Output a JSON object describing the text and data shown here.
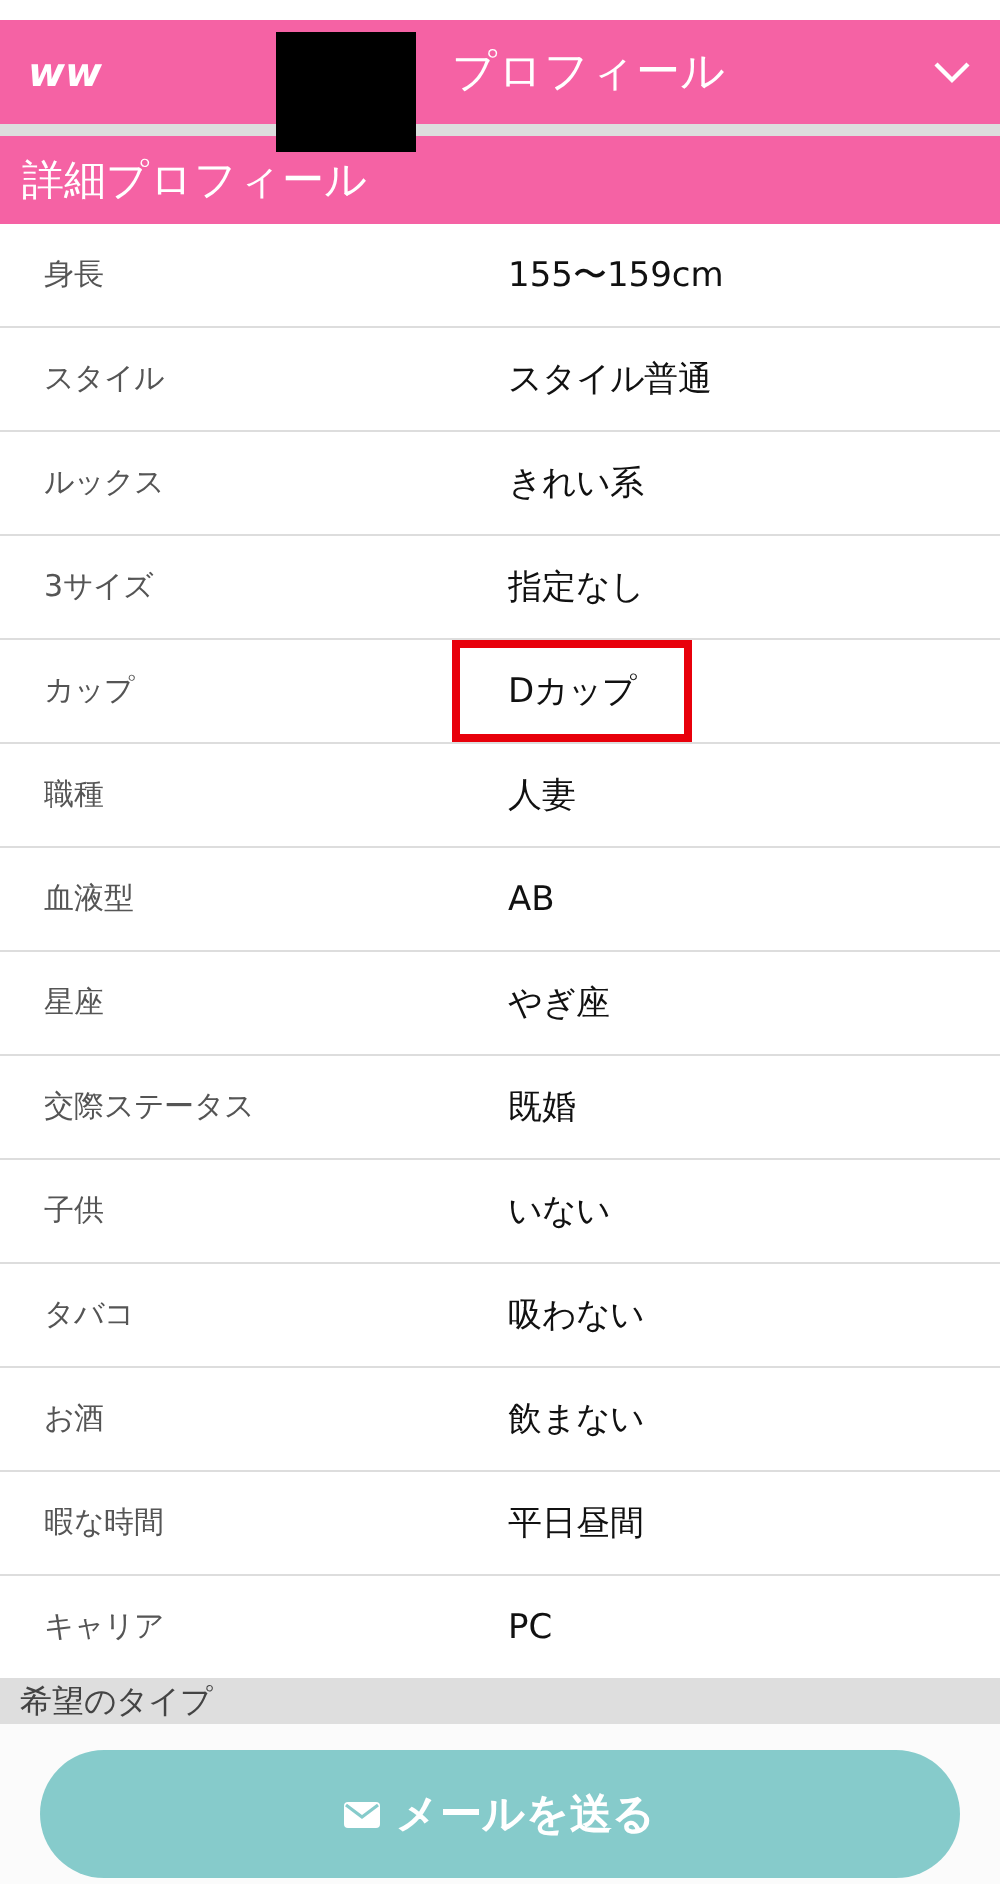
{
  "header": {
    "logo": "ww",
    "title": "プロフィール",
    "redacted": true
  },
  "section": {
    "title": "詳細プロフィール"
  },
  "rows": [
    {
      "label": "身長",
      "value": "155〜159cm",
      "highlighted": false
    },
    {
      "label": "スタイル",
      "value": "スタイル普通",
      "highlighted": false
    },
    {
      "label": "ルックス",
      "value": "きれい系",
      "highlighted": false
    },
    {
      "label": "3サイズ",
      "value": "指定なし",
      "highlighted": false
    },
    {
      "label": "カップ",
      "value": "Dカップ",
      "highlighted": true
    },
    {
      "label": "職種",
      "value": "人妻",
      "highlighted": false
    },
    {
      "label": "血液型",
      "value": "AB",
      "highlighted": false
    },
    {
      "label": "星座",
      "value": "やぎ座",
      "highlighted": false
    },
    {
      "label": "交際ステータス",
      "value": "既婚",
      "highlighted": false
    },
    {
      "label": "子供",
      "value": "いない",
      "highlighted": false
    },
    {
      "label": "タバコ",
      "value": "吸わない",
      "highlighted": false
    },
    {
      "label": "お酒",
      "value": "飲まない",
      "highlighted": false
    },
    {
      "label": "暇な時間",
      "value": "平日昼間",
      "highlighted": false
    },
    {
      "label": "キャリア",
      "value": "PC",
      "highlighted": false
    }
  ],
  "next_section": {
    "title": "希望のタイプ"
  },
  "send_button": {
    "label": "メールを送る"
  }
}
